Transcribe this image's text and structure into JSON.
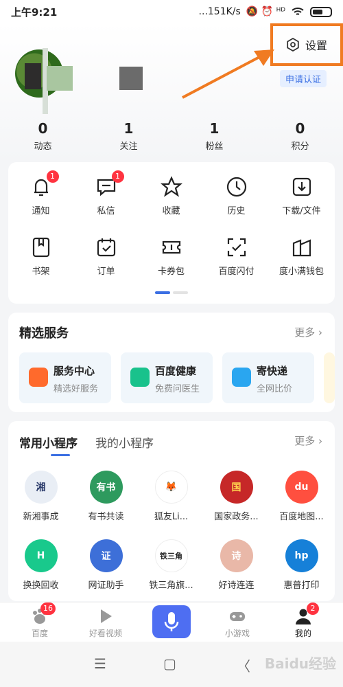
{
  "status": {
    "time": "上午9:21",
    "network": "...151K/s",
    "signal_icons": "🔕 ⏰ ᴴᴰ"
  },
  "settings": {
    "label": "设置"
  },
  "profile": {
    "cert_label": "申请认证"
  },
  "stats": [
    {
      "num": "0",
      "label": "动态"
    },
    {
      "num": "1",
      "label": "关注"
    },
    {
      "num": "1",
      "label": "粉丝"
    },
    {
      "num": "0",
      "label": "积分"
    }
  ],
  "grid": [
    {
      "label": "通知",
      "badge": "1",
      "icon": "bell-icon"
    },
    {
      "label": "私信",
      "badge": "1",
      "icon": "chat-icon"
    },
    {
      "label": "收藏",
      "icon": "star-icon"
    },
    {
      "label": "历史",
      "icon": "clock-icon"
    },
    {
      "label": "下载/文件",
      "icon": "download-icon"
    },
    {
      "label": "书架",
      "icon": "bookshelf-icon"
    },
    {
      "label": "订单",
      "icon": "order-icon"
    },
    {
      "label": "卡券包",
      "icon": "coupon-icon"
    },
    {
      "label": "百度闪付",
      "icon": "scan-pay-icon"
    },
    {
      "label": "度小满钱包",
      "icon": "wallet-icon"
    }
  ],
  "services": {
    "title": "精选服务",
    "more": "更多",
    "items": [
      {
        "title": "服务中心",
        "sub": "精选好服务",
        "color": "#ff6a2c"
      },
      {
        "title": "百度健康",
        "sub": "免费问医生",
        "color": "#19c28c"
      },
      {
        "title": "寄快递",
        "sub": "全网比价",
        "color": "#2aa6f0"
      }
    ]
  },
  "mini": {
    "tab_active": "常用小程序",
    "tab_other": "我的小程序",
    "more": "更多",
    "items": [
      {
        "label": "新湘事成",
        "logo": "湘",
        "color": "#e9eef5",
        "fg": "#2a3a6a"
      },
      {
        "label": "有书共读",
        "logo": "有书",
        "color": "#2e9a5e",
        "fg": "#ffffff"
      },
      {
        "label": "狐友Li...",
        "logo": "🦊",
        "color": "#ffffff",
        "fg": "#e6b800"
      },
      {
        "label": "国家政务...",
        "logo": "国",
        "color": "#c62828",
        "fg": "#ffd54f"
      },
      {
        "label": "百度地图...",
        "logo": "du",
        "color": "#ff4f3f",
        "fg": "#ffffff"
      },
      {
        "label": "换换回收",
        "logo": "H",
        "color": "#19c98c",
        "fg": "#ffffff"
      },
      {
        "label": "网证助手",
        "logo": "证",
        "color": "#3d6fd8",
        "fg": "#ffffff"
      },
      {
        "label": "铁三角旗...",
        "logo": "铁三角",
        "color": "#ffffff",
        "fg": "#222222"
      },
      {
        "label": "好诗连连",
        "logo": "诗",
        "color": "#e9b8a8",
        "fg": "#ffffff"
      },
      {
        "label": "惠普打印",
        "logo": "hp",
        "color": "#1680d8",
        "fg": "#ffffff"
      }
    ]
  },
  "tabbar": [
    {
      "label": "百度",
      "badge": "16",
      "icon": "baidu-paw-icon"
    },
    {
      "label": "好看视频",
      "icon": "play-icon"
    },
    {
      "label": "",
      "icon": "microphone-icon"
    },
    {
      "label": "小游戏",
      "icon": "gamepad-icon"
    },
    {
      "label": "我的",
      "badge": "2",
      "icon": "person-icon"
    }
  ],
  "navbar": {
    "menu": "☰",
    "home": "▢",
    "back": "〈"
  },
  "watermark": "Baidu经验"
}
